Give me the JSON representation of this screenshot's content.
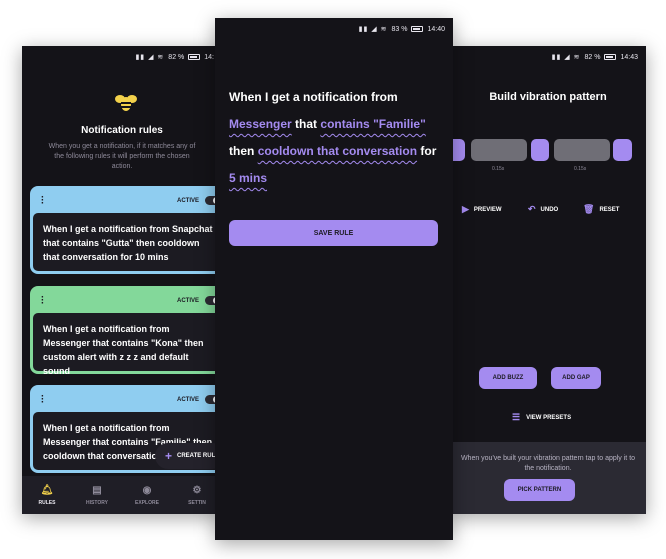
{
  "left_phone": {
    "status": {
      "net": "7.00\nB/s",
      "battery": "82 %",
      "time": "14:"
    },
    "title": "Notification rules",
    "subtitle": "When you get a notification, if it matches any of the following rules it will perform the chosen action.",
    "rules": [
      {
        "status": "ACTIVE",
        "color": "#8fcdf0",
        "text": "When I get a notification from Snapchat that contains \"Gutta\" then cooldown that conversation for 10 mins"
      },
      {
        "status": "ACTIVE",
        "color": "#83d89a",
        "text": "When I get a notification from Messenger that contains \"Kona\" then custom alert with z z z and default sound"
      },
      {
        "status": "ACTIVE",
        "color": "#8fcdf0",
        "text": "When I get a notification from Messenger that contains \"Familie\" then cooldown that conversation for 10 mi"
      }
    ],
    "fab_label": "CREATE RULE",
    "nav": [
      {
        "label": "RULES",
        "icon": "bell-icon",
        "active": true
      },
      {
        "label": "HISTORY",
        "icon": "history-icon",
        "active": false
      },
      {
        "label": "EXPLORE",
        "icon": "compass-icon",
        "active": false
      },
      {
        "label": "SETTIN",
        "icon": "gear-icon",
        "active": false
      }
    ]
  },
  "middle_phone": {
    "status": {
      "net": "0\nK/s",
      "battery": "83 %",
      "time": "14:40"
    },
    "sentence": {
      "prefix": "When I get a notification from",
      "app": "Messenger",
      "that": "that",
      "filter": "contains \"Familie\"",
      "then": "then",
      "action": "cooldown that conversation",
      "for": "for",
      "duration": "5 mins"
    },
    "save_label": "SAVE RULE"
  },
  "right_phone": {
    "status": {
      "net": "7.00\nB/s",
      "battery": "82 %",
      "time": "14:43"
    },
    "title": "Build vibration pattern",
    "pattern_labels": [
      "0.15s",
      "0.15s"
    ],
    "actions": {
      "preview": "PREVIEW",
      "undo": "UNDO",
      "reset": "RESET"
    },
    "add_buzz": "ADD BUZZ",
    "add_gap": "ADD GAP",
    "view_presets": "VIEW PRESETS",
    "hint": "When you've built your vibration pattern tap to apply it to the notification.",
    "pick_label": "PICK PATTERN"
  },
  "colors": {
    "accent": "#a48bf0",
    "background": "#141318",
    "blue": "#8fcdf0",
    "green": "#83d89a"
  }
}
